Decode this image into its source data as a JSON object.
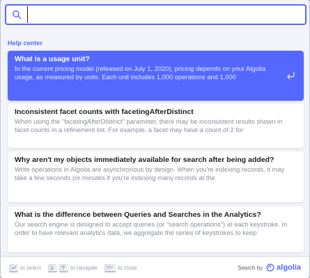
{
  "search": {
    "value": "",
    "placeholder": ""
  },
  "section_title": "Help center",
  "hits": [
    {
      "title": "What is a usage unit?",
      "snippet": "In the current pricing model (released on July 1, 2020), pricing depends on your Algolia usage, as measured by units. Each unit includes 1,000 operations and 1,000",
      "active": true
    },
    {
      "title": "Inconsistent facet counts with facetingAfterDistinct",
      "snippet": "When using the \"facetingAfterDistinct\" parameter, there may be inconsistent results shown in facet counts in a refinement list. For example, a facet may have a count of 2 for",
      "active": false
    },
    {
      "title": "Why aren't my objects immediately available for search after being added?",
      "snippet": "Write operations in Algolia are asynchronous by design. When you're indexing records, it may take a few seconds (or minutes if you're indexing many records at the",
      "active": false
    },
    {
      "title": "What is the difference between Queries and Searches in the Analytics?",
      "snippet": "Our search engine is designed to accept queries (or \"search operations\") at each keystroke. In order to have relevant analytics data, we aggregate the series of keystrokes to keep",
      "active": false
    }
  ],
  "footer": {
    "select_label": "to select",
    "navigate_label": "to navigate",
    "esc_key": "esc",
    "close_label": "to close",
    "search_by": "Search by",
    "brand": "algolia"
  },
  "colors": {
    "accent": "#5468ff",
    "background": "#f3f4f9",
    "muted_text": "#8a8e9e"
  },
  "icons": [
    "search-icon",
    "enter-icon",
    "enter-key-icon",
    "arrow-down-icon",
    "arrow-up-icon",
    "algolia-logo-icon"
  ]
}
